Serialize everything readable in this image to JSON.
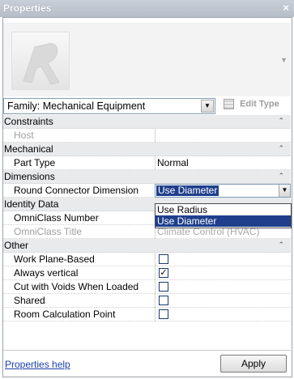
{
  "window": {
    "title": "Properties",
    "close_glyph": "×"
  },
  "type_selector": {
    "value": "Family: Mechanical Equipment",
    "edit_type_label": "Edit Type"
  },
  "rows": [
    {
      "kind": "category",
      "label": "Constraints"
    },
    {
      "kind": "param",
      "label": "Host",
      "value": "",
      "disabled": true
    },
    {
      "kind": "category",
      "label": "Mechanical"
    },
    {
      "kind": "param",
      "label": "Part Type",
      "value": "Normal"
    },
    {
      "kind": "category",
      "label": "Dimensions"
    },
    {
      "kind": "param",
      "label": "Round Connector Dimension",
      "value": "Use Diameter",
      "editor": "combo"
    },
    {
      "kind": "category",
      "label": "Identity Data"
    },
    {
      "kind": "param",
      "label": "OmniClass Number",
      "value": ""
    },
    {
      "kind": "param",
      "label": "OmniClass Title",
      "value": "Climate Control (HVAC)",
      "disabled": true
    },
    {
      "kind": "category",
      "label": "Other"
    },
    {
      "kind": "param",
      "label": "Work Plane-Based",
      "checked": false
    },
    {
      "kind": "param",
      "label": "Always vertical",
      "checked": true
    },
    {
      "kind": "param",
      "label": "Cut with Voids When Loaded",
      "checked": false
    },
    {
      "kind": "param",
      "label": "Shared",
      "checked": false
    },
    {
      "kind": "param",
      "label": "Room Calculation Point",
      "checked": false
    }
  ],
  "dropdown": {
    "options": [
      "Use Radius",
      "Use Diameter"
    ],
    "selected": "Use Diameter"
  },
  "footer": {
    "help_link": "Properties help",
    "apply_label": "Apply"
  },
  "icons": {
    "collapse": "chevron-up-icon",
    "check": "checkmark-icon"
  }
}
